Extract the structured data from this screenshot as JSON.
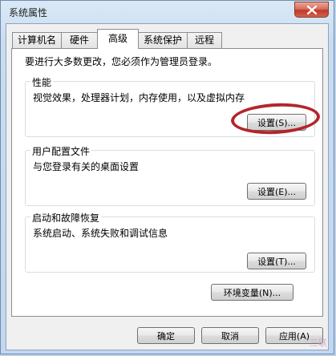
{
  "window": {
    "title": "系统属性"
  },
  "tabs": [
    {
      "label": "计算机名"
    },
    {
      "label": "硬件"
    },
    {
      "label": "高级"
    },
    {
      "label": "系统保护"
    },
    {
      "label": "远程"
    }
  ],
  "notice": "要进行大多数更改，您必须作为管理员登录。",
  "performance": {
    "title": "性能",
    "desc": "视觉效果，处理器计划，内存使用，以及虚拟内存",
    "button": "设置(S)..."
  },
  "user_profiles": {
    "title": "用户配置文件",
    "desc": "与您登录有关的桌面设置",
    "button": "设置(E)..."
  },
  "startup_recovery": {
    "title": "启动和故障恢复",
    "desc": "系统启动、系统失败和调试信息",
    "button": "设置(T)..."
  },
  "env_button": "环境变量(N)...",
  "footer": {
    "ok": "确定",
    "cancel": "取消",
    "apply": "应用(A)"
  },
  "watermark": "三联",
  "colors": {
    "highlight_ring": "#b3262b",
    "close_button": "#c0392b"
  },
  "icons": {
    "close": "close-icon"
  }
}
